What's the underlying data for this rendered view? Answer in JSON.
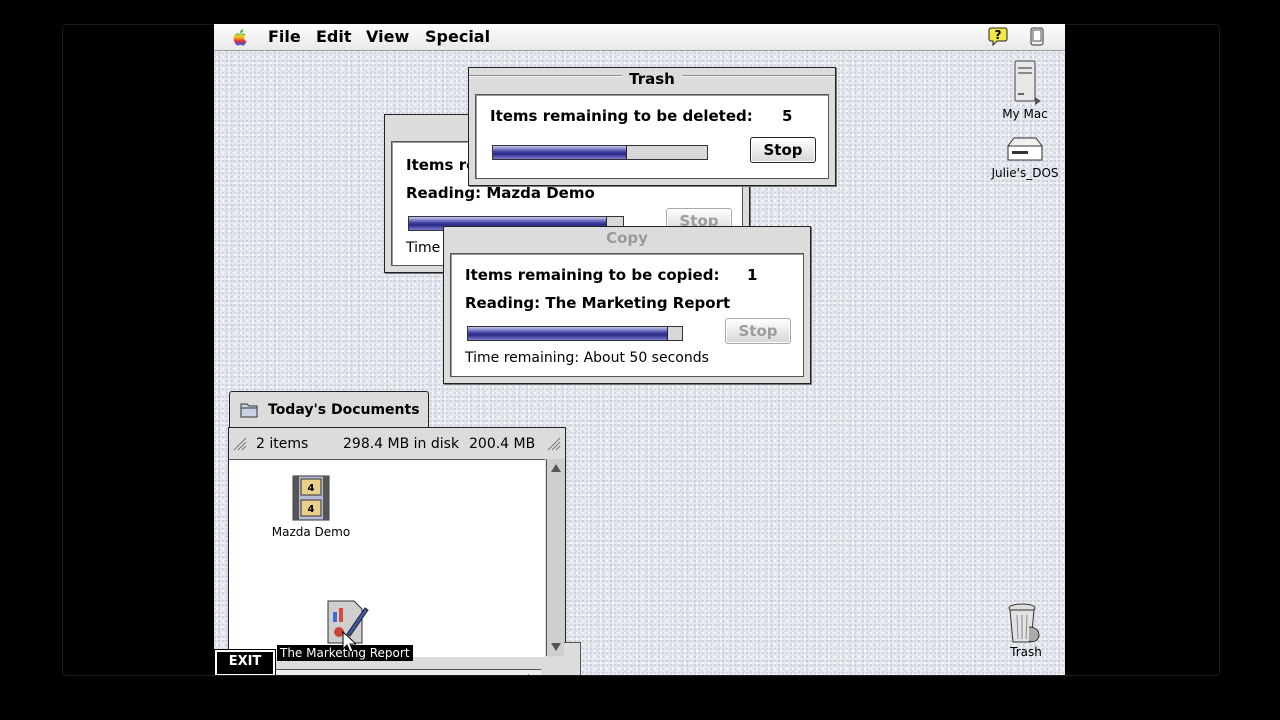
{
  "menubar": {
    "items": [
      "File",
      "Edit",
      "View",
      "Special"
    ],
    "help_icon": "help-balloon-icon",
    "app_strip_icon": "application-switcher-icon"
  },
  "desktop_icons": [
    {
      "label": "My Mac",
      "icon": "computer-icon"
    },
    {
      "label": "Julie's_DOS",
      "icon": "disk-icon"
    },
    {
      "label": "Trash",
      "icon": "trash-icon"
    }
  ],
  "trash_window": {
    "title": "Trash",
    "items_label": "Items remaining to be deleted:",
    "items_count": "5",
    "progress": 0.62,
    "stop_label": "Stop"
  },
  "back_copy_window": {
    "items_label": "Items re",
    "reading": "Reading: Mazda Demo",
    "time_label": "Time",
    "progress": 0.92,
    "stop_label": "Stop"
  },
  "copy_window": {
    "title": "Copy",
    "items_label": "Items remaining to be copied:",
    "items_count": "1",
    "reading": "Reading: The Marketing Report",
    "progress": 0.93,
    "stop_label": "Stop",
    "time_remaining": "Time remaining:  About 50 seconds"
  },
  "folder_window": {
    "title": "Today's Documents",
    "item_count": "2 items",
    "disk_used": "298.4 MB in disk",
    "available": "200.4 MB",
    "items": [
      {
        "label": "Mazda Demo",
        "icon": "movie-file-icon",
        "selected": false
      },
      {
        "label": "The Marketing Report",
        "icon": "document-icon",
        "selected": true
      }
    ]
  },
  "exit_button": "EXIT",
  "colors": {
    "progress": "#3a3a98",
    "desktop": "#e6e9f0",
    "window": "#dcdcdc"
  }
}
